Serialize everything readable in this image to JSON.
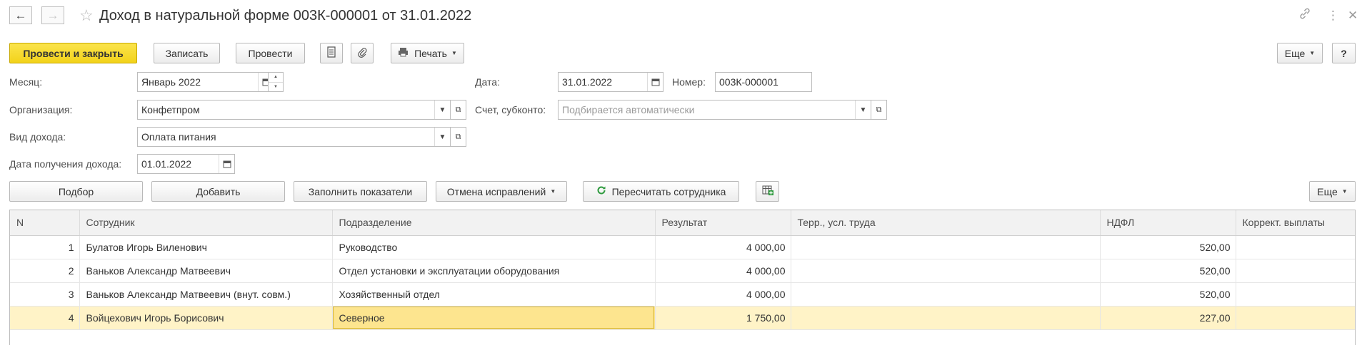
{
  "window": {
    "title": "Доход в натуральной форме 003К-000001 от 31.01.2022"
  },
  "toolbar": {
    "post_and_close": "Провести и закрыть",
    "save": "Записать",
    "post": "Провести",
    "print": "Печать",
    "more": "Еще",
    "help": "?"
  },
  "form": {
    "month_label": "Месяц:",
    "month_value": "Январь 2022",
    "org_label": "Организация:",
    "org_value": "Конфетпром",
    "income_type_label": "Вид дохода:",
    "income_type_value": "Оплата питания",
    "income_date_label": "Дата получения дохода:",
    "income_date_value": "01.01.2022",
    "date_label": "Дата:",
    "date_value": "31.01.2022",
    "number_label": "Номер:",
    "number_value": "003К-000001",
    "account_label": "Счет, субконто:",
    "account_placeholder": "Подбирается автоматически"
  },
  "table_toolbar": {
    "select": "Подбор",
    "add": "Добавить",
    "fill": "Заполнить показатели",
    "cancel_corrections": "Отмена исправлений",
    "recalc": "Пересчитать сотрудника",
    "more": "Еще"
  },
  "table": {
    "columns": [
      "N",
      "Сотрудник",
      "Подразделение",
      "Результат",
      "Терр., усл. труда",
      "НДФЛ",
      "Коррект. выплаты"
    ],
    "rows": [
      {
        "n": "1",
        "employee": "Булатов Игорь Виленович",
        "department": "Руководство",
        "result": "4 000,00",
        "terr": "",
        "ndfl": "520,00",
        "correction": ""
      },
      {
        "n": "2",
        "employee": "Ваньков Александр Матвеевич",
        "department": "Отдел установки и эксплуатации оборудования",
        "result": "4 000,00",
        "terr": "",
        "ndfl": "520,00",
        "correction": ""
      },
      {
        "n": "3",
        "employee": "Ваньков Александр Матвеевич (внут. совм.)",
        "department": "Хозяйственный отдел",
        "result": "4 000,00",
        "terr": "",
        "ndfl": "520,00",
        "correction": ""
      },
      {
        "n": "4",
        "employee": "Войцехович Игорь Борисович",
        "department": "Северное",
        "result": "1 750,00",
        "terr": "",
        "ndfl": "227,00",
        "correction": ""
      }
    ]
  },
  "colors": {
    "primary_button": "#f2d21a",
    "selected_row": "#fff3c7",
    "active_cell": "#fde58f",
    "recalc_icon": "#2e9a3e"
  }
}
